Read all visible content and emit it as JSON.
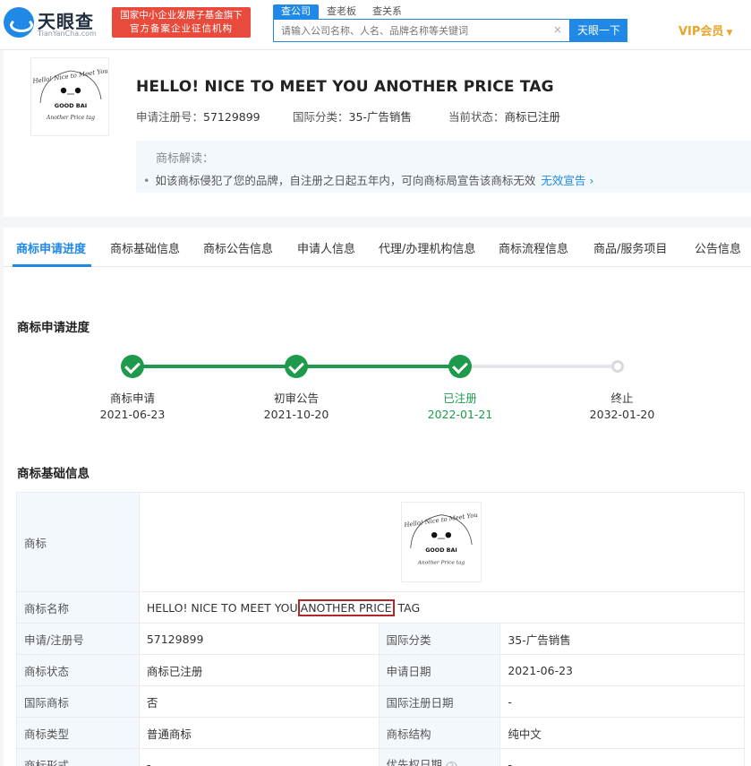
{
  "header": {
    "logo_text": "天眼查",
    "logo_sub": "TianYanCha.com",
    "gov_line1": "国家中小企业发展子基金旗下",
    "gov_line2": "官方备案企业征信机构",
    "search_tabs": [
      "查公司",
      "查老板",
      "查关系"
    ],
    "search_placeholder": "请输入公司名称、人名、品牌名称等关键词",
    "search_clear": "×",
    "search_button": "天眼一下",
    "vip_label": "VIP会员"
  },
  "trademark": {
    "title": "HELLO! NICE TO MEET YOU ANOTHER PRICE TAG",
    "reg_no_label": "申请注册号：",
    "reg_no": "57129899",
    "class_label": "国际分类：",
    "class": "35-广告销售",
    "status_label": "当前状态：",
    "status": "商标已注册",
    "logo_script_top": "Hello! Nice to Meet You",
    "logo_brand": "GOOD BAI",
    "logo_script_bottom": "Another Price tag"
  },
  "interpretation": {
    "heading": "商标解读：",
    "text": "如该商标侵犯了您的品牌，自注册之日起五年内，可向商标局宣告该商标无效",
    "link": "无效宣告"
  },
  "tabs": [
    "商标申请进度",
    "商标基础信息",
    "商标公告信息",
    "申请人信息",
    "代理/办理机构信息",
    "商标流程信息",
    "商品/服务项目",
    "公告信息"
  ],
  "progress": {
    "title": "商标申请进度",
    "steps": [
      {
        "label": "商标申请",
        "date": "2021-06-23"
      },
      {
        "label": "初审公告",
        "date": "2021-10-20"
      },
      {
        "label": "已注册",
        "date": "2022-01-21"
      },
      {
        "label": "终止",
        "date": "2032-01-20"
      }
    ]
  },
  "basic_info": {
    "title": "商标基础信息",
    "logo_key": "商标",
    "name_key": "商标名称",
    "name_before": "HELLO! NICE TO MEET YOU",
    "name_highlight": "ANOTHER PRICE",
    "name_after": "TAG",
    "rows": [
      {
        "k1": "申请/注册号",
        "v1": "57129899",
        "k2": "国际分类",
        "v2": "35-广告销售"
      },
      {
        "k1": "商标状态",
        "v1": "商标已注册",
        "k2": "申请日期",
        "v2": "2021-06-23"
      },
      {
        "k1": "国际商标",
        "v1": "否",
        "k2": "国际注册日期",
        "v2": "-"
      },
      {
        "k1": "商标类型",
        "v1": "普通商标",
        "k2": "商标结构",
        "v2": "纯中文"
      },
      {
        "k1": "商标形式",
        "v1": "-",
        "k2": "优先权日期",
        "v2": "-"
      }
    ]
  },
  "colors": {
    "brand_blue": "#1f89e5",
    "done_green": "#1e9a4d",
    "highlight_red": "#b3262a",
    "vip_gold": "#e9a52a"
  }
}
